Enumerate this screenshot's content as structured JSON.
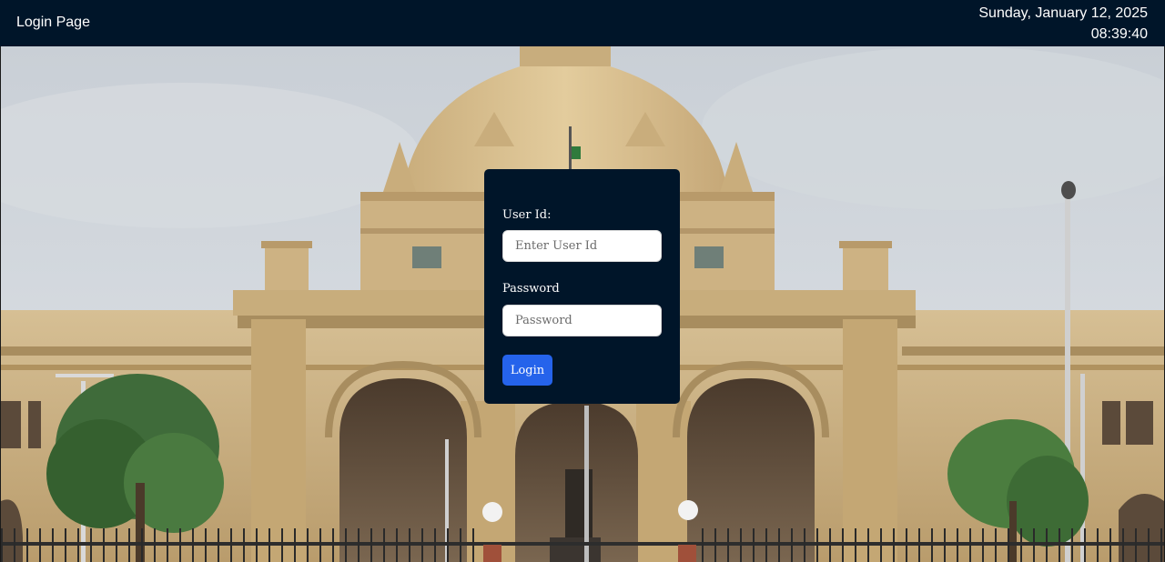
{
  "header": {
    "title": "Login Page",
    "date": "Sunday, January 12, 2025",
    "time": "08:39:40"
  },
  "hero": {
    "image": "assembly-building-photo"
  },
  "login_form": {
    "user_label": "User Id:",
    "user_placeholder": "Enter User Id",
    "password_label": "Password",
    "password_placeholder": "Password",
    "submit_label": "Login"
  },
  "colors": {
    "header_bg": "#001529",
    "card_bg": "#001529",
    "button_bg": "#2563eb"
  }
}
